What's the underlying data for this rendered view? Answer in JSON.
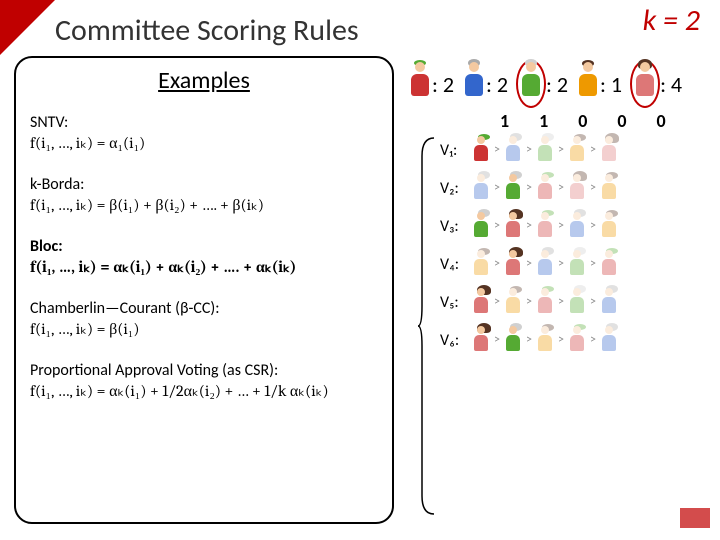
{
  "title": "Committee Scoring Rules",
  "k_label": "k = 2",
  "examples_header": "Examples",
  "rules": {
    "sntv": {
      "name": "SNTV:",
      "formula": "f(i₁, …, iₖ) = α₁(i₁)"
    },
    "kborda": {
      "name": "k-Borda:",
      "formula": "f(i₁, …, iₖ) = β(i₁) + β(i₂) + …. + β(iₖ)"
    },
    "bloc": {
      "name": "Bloc:",
      "formula": "f(i₁, …, iₖ) = αₖ(i₁) + αₖ(i₂) + …. + αₖ(iₖ)"
    },
    "cc": {
      "name": "Chamberlin—Courant (β-CC):",
      "formula": "f(i₁, …, iₖ) = β(i₁)"
    },
    "pav": {
      "name": "Proportional Approval Voting (as CSR):",
      "formula": "f(i₁, …, iₖ) = αₖ(i₁) + 1/2αₖ(i₂) + … + 1/k αₖ(iₖ)"
    }
  },
  "candidates": [
    {
      "color": "red",
      "score": ": 2",
      "circled": false
    },
    {
      "color": "blue",
      "score": ": 2",
      "circled": false
    },
    {
      "color": "green",
      "score": ": 2",
      "circled": true
    },
    {
      "color": "orange",
      "score": ": 1",
      "circled": false
    },
    {
      "color": "pink",
      "score": ": 4",
      "circled": true
    }
  ],
  "digits": [
    "1",
    "1",
    "0",
    "0",
    "0"
  ],
  "voters": [
    {
      "label": "V₁:",
      "order": [
        "red",
        "blue",
        "green",
        "orange",
        "pink"
      ],
      "bold": [
        0
      ]
    },
    {
      "label": "V₂:",
      "order": [
        "blue",
        "green",
        "red",
        "pink",
        "orange"
      ],
      "bold": [
        1
      ]
    },
    {
      "label": "V₃:",
      "order": [
        "green",
        "pink",
        "red",
        "blue",
        "orange"
      ],
      "bold": [
        0,
        1
      ]
    },
    {
      "label": "V₄:",
      "order": [
        "orange",
        "pink",
        "blue",
        "green",
        "red"
      ],
      "bold": [
        1
      ]
    },
    {
      "label": "V₅:",
      "order": [
        "pink",
        "orange",
        "red",
        "green",
        "blue"
      ],
      "bold": [
        0
      ]
    },
    {
      "label": "V₆:",
      "order": [
        "pink",
        "green",
        "orange",
        "red",
        "blue"
      ],
      "bold": [
        0,
        1
      ]
    }
  ]
}
